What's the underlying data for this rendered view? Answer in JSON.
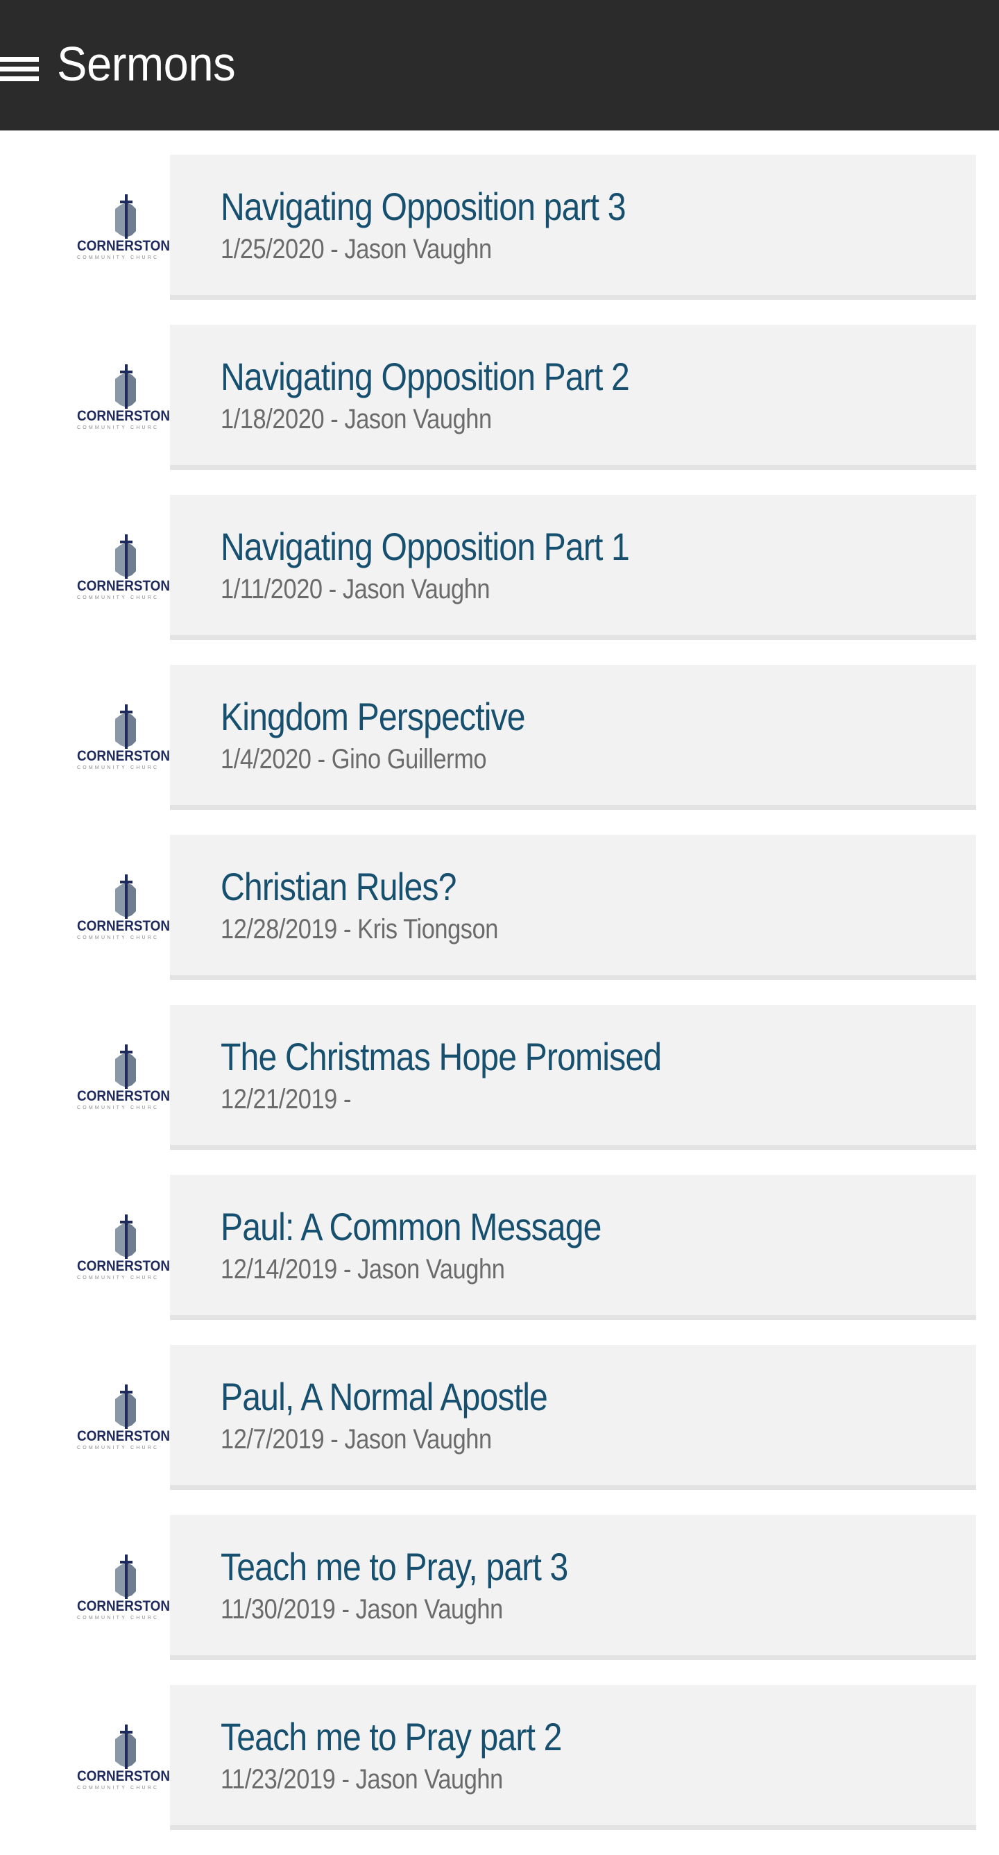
{
  "header": {
    "title": "Sermons",
    "menu_icon": "hamburger-menu-icon",
    "background_color": "#2b2b2b"
  },
  "logo": {
    "name": "CORNERSTON",
    "subtitle": "COMMUNITY CHURC",
    "icon": "cross-over-cornerstone-icon",
    "colors": {
      "cross": "#1f2a5c",
      "stone": "#7a8898",
      "text": "#1f2a5c",
      "subtitle": "#8a8a8a"
    }
  },
  "theme": {
    "card_background": "#f2f2f2",
    "card_shadow": "#e3e3e3",
    "title_color": "#17506f",
    "meta_color": "#6b6b6b"
  },
  "sermons": [
    {
      "title": "Navigating Opposition part 3",
      "meta": "1/25/2020 - Jason Vaughn",
      "date": "1/25/2020",
      "speaker": "Jason Vaughn"
    },
    {
      "title": "Navigating Opposition Part 2",
      "meta": "1/18/2020 - Jason Vaughn",
      "date": "1/18/2020",
      "speaker": "Jason Vaughn"
    },
    {
      "title": "Navigating Opposition Part 1",
      "meta": "1/11/2020 - Jason Vaughn",
      "date": "1/11/2020",
      "speaker": "Jason Vaughn"
    },
    {
      "title": "Kingdom Perspective",
      "meta": "1/4/2020 - Gino Guillermo",
      "date": "1/4/2020",
      "speaker": "Gino Guillermo"
    },
    {
      "title": "Christian Rules?",
      "meta": "12/28/2019 - Kris Tiongson",
      "date": "12/28/2019",
      "speaker": "Kris Tiongson"
    },
    {
      "title": "The Christmas Hope Promised",
      "meta": "12/21/2019 -",
      "date": "12/21/2019",
      "speaker": ""
    },
    {
      "title": "Paul: A Common Message",
      "meta": "12/14/2019 - Jason Vaughn",
      "date": "12/14/2019",
      "speaker": "Jason Vaughn"
    },
    {
      "title": "Paul, A Normal Apostle",
      "meta": "12/7/2019 - Jason Vaughn",
      "date": "12/7/2019",
      "speaker": "Jason Vaughn"
    },
    {
      "title": "Teach me to Pray, part 3",
      "meta": "11/30/2019 - Jason Vaughn",
      "date": "11/30/2019",
      "speaker": "Jason Vaughn"
    },
    {
      "title": "Teach me to Pray part 2",
      "meta": "11/23/2019 - Jason Vaughn",
      "date": "11/23/2019",
      "speaker": "Jason Vaughn"
    }
  ]
}
